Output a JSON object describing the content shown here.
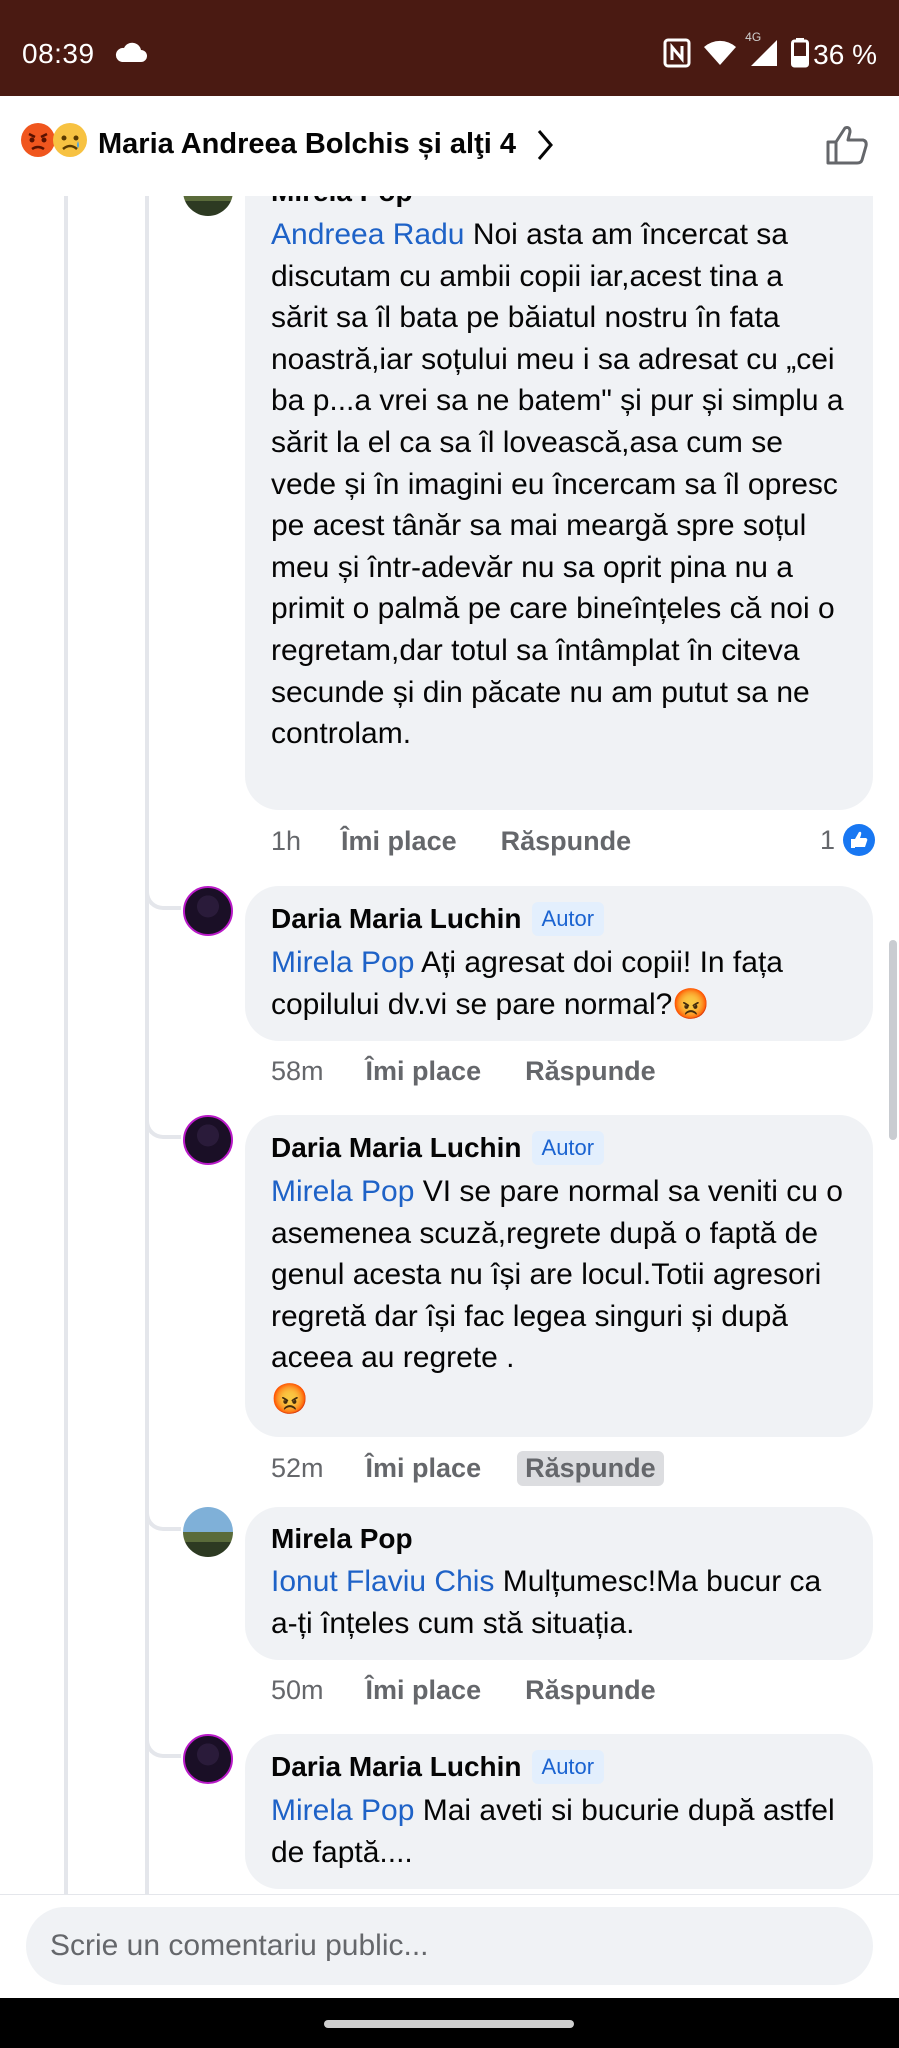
{
  "status_bar": {
    "time": "08:39",
    "network": "4G",
    "battery": "36 %"
  },
  "header": {
    "title": "Maria Andreea Bolchis și alţi 4",
    "reaction_icons": [
      "angry-emoji",
      "sad-emoji"
    ]
  },
  "comments": [
    {
      "author": "Mirela Pop",
      "mention": "Andreea Radu",
      "text": " Noi asta am încercat sa discutam cu ambii copii iar,acest tina a sărit sa îl bata pe băiatul nostru în fata noastră,iar soțului meu i sa adresat cu „cei ba p...a vrei sa ne batem\" și pur și simplu a sărit la el ca sa îl lovească,asa cum se vede și în imagini eu încercam sa îl opresc pe acest tânăr sa mai meargă spre soțul meu și într-adevăr nu sa oprit pina nu a primit o palmă pe care bineînțeles că noi o regretam,dar totul sa întâmplat în citeva secunde și din păcate nu am putut sa ne controlam.",
      "time": "1h",
      "like": "Îmi place",
      "reply": "Răspunde",
      "reactions": "1"
    },
    {
      "author": "Daria Maria Luchin",
      "badge": "Autor",
      "mention": "Mirela Pop",
      "text": " Ați  agresat doi copii! In fața copilului dv.vi se pare normal?",
      "emoji": "😡",
      "time": "58m",
      "like": "Îmi place",
      "reply": "Răspunde"
    },
    {
      "author": "Daria Maria Luchin",
      "badge": "Autor",
      "mention": "Mirela Pop",
      "text": " VI se pare normal sa veniti cu o asemenea scuză,regrete după o faptă de genul acesta nu își are locul.Totii agresori regretă dar își fac legea singuri și după aceea au regrete .",
      "emoji": "😡",
      "time": "52m",
      "like": "Îmi place",
      "reply": "Răspunde"
    },
    {
      "author": "Mirela Pop",
      "mention": "Ionut Flaviu Chis",
      "text": " Mulțumesc!Ma bucur ca a-ți înțeles cum stă situația.",
      "time": "50m",
      "like": "Îmi place",
      "reply": "Răspunde"
    },
    {
      "author": "Daria Maria Luchin",
      "badge": "Autor",
      "mention": "Mirela Pop",
      "text": " Mai aveti si bucurie după astfel de faptă...."
    }
  ],
  "composer": {
    "placeholder": "Scrie un comentariu public..."
  }
}
